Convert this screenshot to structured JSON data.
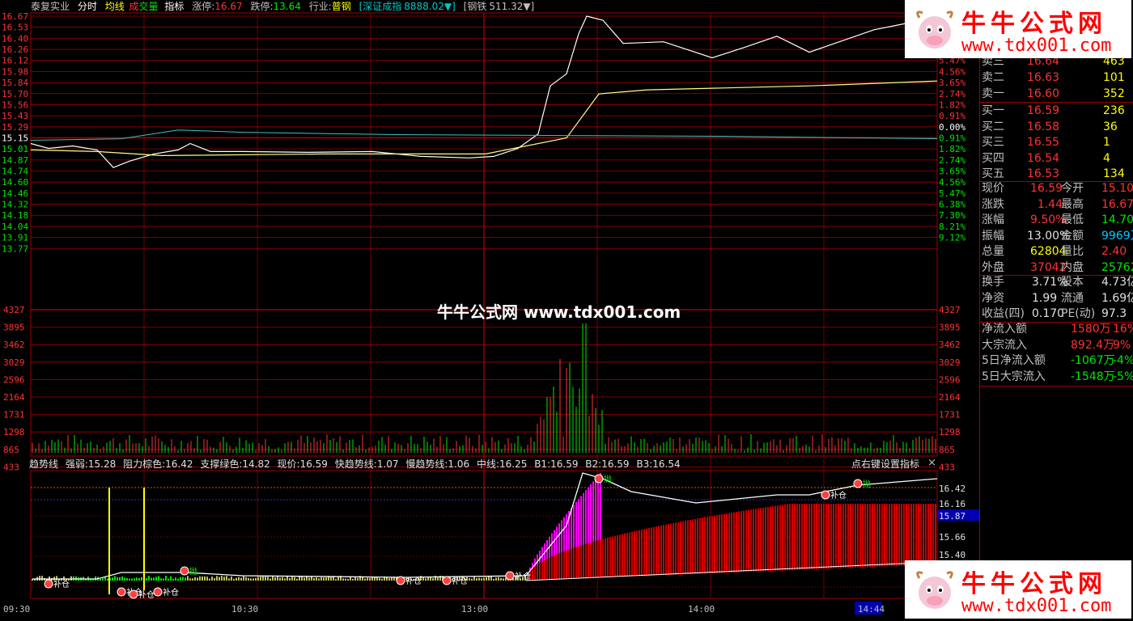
{
  "header": {
    "stock_name": "泰复实业",
    "tab_fenshi": "分时",
    "tab_junxian": "均线",
    "tab_chengjiaoliang_a": "成",
    "tab_chengjiaoliang_b": "交量",
    "tab_zhibiao": "指标",
    "zhangting_label": "涨停:",
    "zhangting_value": "16.67",
    "dieting_label": "跌停:",
    "dieting_value": "13.64",
    "hangye_label": "行业:",
    "hangye_value": "普钢",
    "index_name": "[深证成指",
    "index_value": "8888.02▼]",
    "sector_name": "[钢铁",
    "sector_value": "511.32▼]"
  },
  "price_axis_left": [
    "16.67",
    "16.53",
    "16.40",
    "16.26",
    "16.12",
    "15.98",
    "15.84",
    "15.70",
    "15.56",
    "15.43",
    "15.29",
    "15.15",
    "15.01",
    "14.87",
    "14.74",
    "14.60",
    "14.46",
    "14.32",
    "14.18",
    "14.04",
    "13.91",
    "13.77"
  ],
  "pct_axis_right": [
    "",
    "",
    "",
    "6.38%",
    "5.47%",
    "4.56%",
    "3.65%",
    "2.74%",
    "1.82%",
    "0.91%",
    "0.00%",
    "0.91%",
    "1.82%",
    "2.74%",
    "3.65%",
    "4.56%",
    "5.47%",
    "6.38%",
    "7.30%",
    "8.21%",
    "9.12%"
  ],
  "volume_axis": [
    "4327",
    "3895",
    "3462",
    "3029",
    "2596",
    "2164",
    "1731",
    "1298",
    "865",
    "433"
  ],
  "indicator_axis": [
    "16.42",
    "16.16",
    "15.87",
    "15.66",
    "15.40"
  ],
  "time_axis": [
    "09:30",
    "10:30",
    "13:00",
    "14:00",
    "14:44"
  ],
  "indicator_bar": {
    "name": "趋势线",
    "qiangruo": "强弱:15.28",
    "zuli": "阻力棕色:16.42",
    "zhicheng": "支撑绿色:14.82",
    "xianjia": "现价:16.59",
    "kuai": "快趋势线:1.07",
    "man": "慢趋势线:1.06",
    "zhongxian": "中线:16.25",
    "b1": "B1:16.59",
    "b2": "B2:16.59",
    "b3": "B3:16.54",
    "settings": "点右键设置指标",
    "close": "×"
  },
  "indicator_markers": [
    "补仓",
    "补仓",
    "补仓",
    "补仓",
    "补仓",
    "补仓",
    "补仓",
    "补仓",
    "抛",
    "抛",
    "抛"
  ],
  "center_watermark": "牛牛公式网 www.tdx001.com",
  "watermark": {
    "title": "牛牛公式网",
    "url": "www.tdx001.com"
  },
  "order_book": {
    "sell": [
      {
        "label": "卖三",
        "price": "16.64",
        "vol": "463"
      },
      {
        "label": "卖二",
        "price": "16.63",
        "vol": "101"
      },
      {
        "label": "卖一",
        "price": "16.60",
        "vol": "352"
      }
    ],
    "buy": [
      {
        "label": "买一",
        "price": "16.59",
        "vol": "236"
      },
      {
        "label": "买二",
        "price": "16.58",
        "vol": "36"
      },
      {
        "label": "买三",
        "price": "16.55",
        "vol": "1"
      },
      {
        "label": "买四",
        "price": "16.54",
        "vol": "4"
      },
      {
        "label": "买五",
        "price": "16.53",
        "vol": "134"
      }
    ]
  },
  "quote": [
    {
      "l1": "现价",
      "v1": "16.59",
      "l2": "今开",
      "v2": "15.10"
    },
    {
      "l1": "涨跌",
      "v1": "1.44",
      "l2": "最高",
      "v2": "16.67"
    },
    {
      "l1": "涨幅",
      "v1": "9.50%",
      "l2": "最低",
      "v2": "14.70"
    },
    {
      "l1": "振幅",
      "v1": "13.00%",
      "l2": "金额",
      "v2": "9969万"
    },
    {
      "l1": "总量",
      "v1": "62804",
      "l2": "量比",
      "v2": "2.40"
    },
    {
      "l1": "外盘",
      "v1": "37042",
      "l2": "内盘",
      "v2": "25762"
    }
  ],
  "fundamentals": [
    {
      "l1": "换手",
      "v1": "3.71%",
      "l2": "股本",
      "v2": "4.73亿"
    },
    {
      "l1": "净资",
      "v1": "1.99",
      "l2": "流通",
      "v2": "1.69亿"
    },
    {
      "l1": "收益(四)",
      "v1": "0.170",
      "l2": "PE(动)",
      "v2": "97.3"
    }
  ],
  "flows": [
    {
      "label": "净流入额",
      "v": "1580万",
      "p": "16%"
    },
    {
      "label": "大宗流入",
      "v": "892.4万",
      "p": "9%"
    },
    {
      "label": "5日净流入额",
      "v": "-1067万",
      "p": "-4%"
    },
    {
      "label": "5日大宗流入",
      "v": "-1548万",
      "p": "-5%"
    }
  ],
  "colors": {
    "grid": "#a00000",
    "up": "#ff3232",
    "down": "#00e600",
    "price": "#ffffff",
    "avg": "#ffff80",
    "index": "#40c0c0",
    "magenta": "#ff00ff"
  },
  "icons": [
    "close-icon",
    "cow-logo-icon",
    "arrow-down-icon"
  ]
}
